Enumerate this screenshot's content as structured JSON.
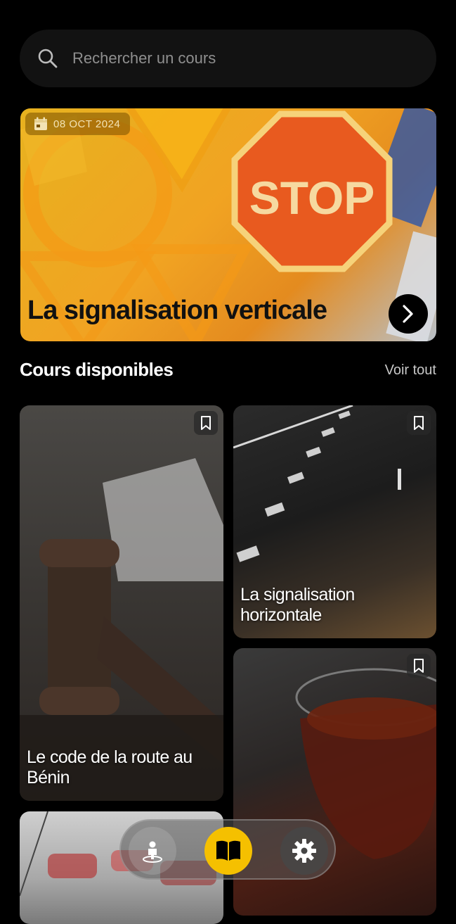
{
  "search": {
    "placeholder": "Rechercher un cours"
  },
  "featured": {
    "date": "08 OCT 2024",
    "title": "La signalisation verticale",
    "sign_text": "STOP"
  },
  "section": {
    "title": "Cours disponibles",
    "see_all": "Voir tout"
  },
  "courses": [
    {
      "title": "Le code de la route au Bénin",
      "icon": "bookmark-icon"
    },
    {
      "title": "La signalisation horizontale",
      "icon": "bookmark-icon"
    },
    {
      "title": "",
      "icon": "bookmark-icon"
    },
    {
      "title": "",
      "icon": "bookmark-icon"
    }
  ],
  "nav": {
    "items": [
      "person-pin-icon",
      "book-icon",
      "gear-icon"
    ],
    "active": "book-icon",
    "accent": "#f5c000"
  }
}
